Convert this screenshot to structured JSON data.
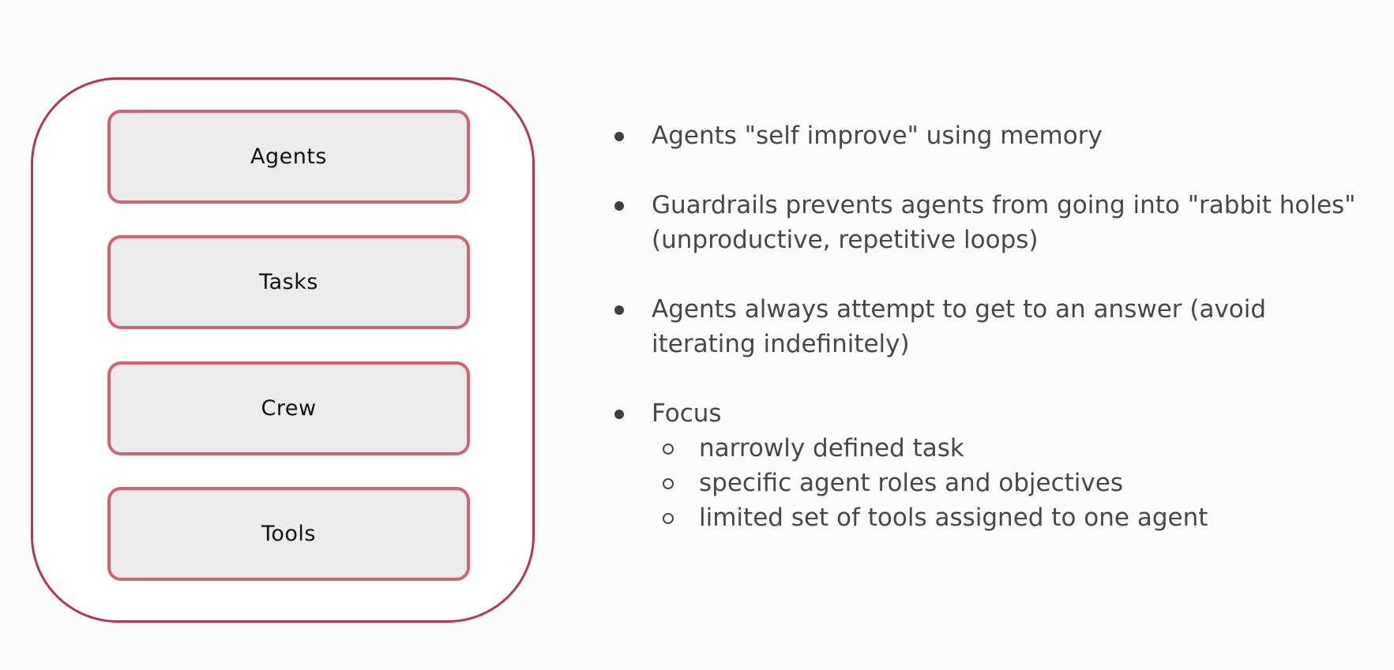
{
  "diagram": {
    "components": [
      {
        "label": "Agents"
      },
      {
        "label": "Tasks"
      },
      {
        "label": "Crew"
      },
      {
        "label": "Tools"
      }
    ],
    "colors": {
      "outer_border": "#b8354f",
      "box_border": "#d66173",
      "box_fill": "#ebebeb"
    }
  },
  "bullets": {
    "items": [
      {
        "text": "Agents \"self improve\" using memory"
      },
      {
        "text": "Guardrails prevents agents from going into \"rabbit holes\" (unproductive, repetitive loops)"
      },
      {
        "text": "Agents always attempt to get to an answer (avoid iterating indefinitely)"
      },
      {
        "text": "Focus"
      }
    ],
    "focus_subitems": [
      {
        "text": "narrowly defined task"
      },
      {
        "text": "specific agent roles and objectives"
      },
      {
        "text": "limited set of tools assigned to one agent"
      }
    ]
  }
}
